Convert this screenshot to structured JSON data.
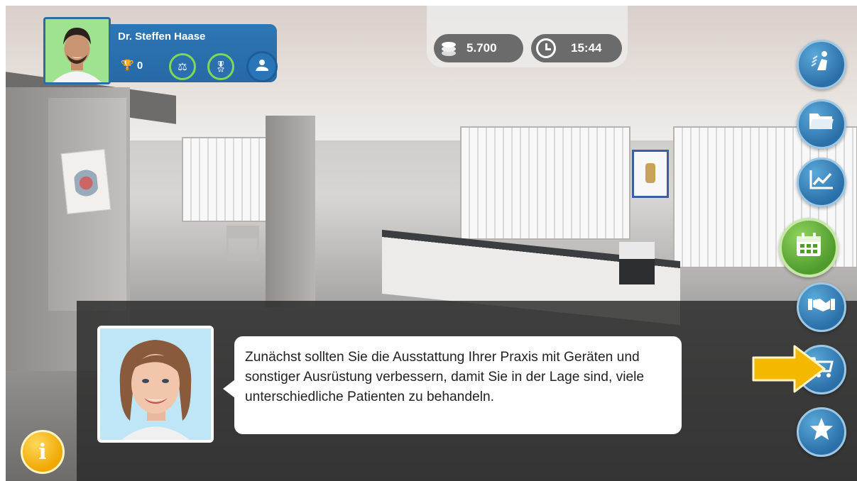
{
  "player": {
    "name": "Dr. Steffen Haase",
    "trophies": "0",
    "badges": [
      "scale-icon",
      "award-icon",
      "user-hand-icon"
    ]
  },
  "resources": {
    "money": "5.700",
    "time": "15:44"
  },
  "side_menu": [
    {
      "id": "staff",
      "icon": "staff-icon"
    },
    {
      "id": "files",
      "icon": "folder-icon"
    },
    {
      "id": "stats",
      "icon": "chart-icon"
    },
    {
      "id": "calendar",
      "icon": "calendar-icon",
      "active": true
    },
    {
      "id": "deal",
      "icon": "handshake-icon"
    },
    {
      "id": "shop",
      "icon": "cart-icon",
      "highlighted": true
    },
    {
      "id": "favorites",
      "icon": "star-icon"
    }
  ],
  "dialogue": {
    "text": "Zunächst sollten Sie die Ausstattung Ihrer Praxis mit Geräten und sonstiger Ausrüstung verbessern, damit Sie in der Lage sind, viele unterschiedliche Patienten zu behandeln."
  },
  "colors": {
    "primary_blue": "#2b6fa8",
    "badge_green": "#7ed957",
    "highlight_yellow": "#f5b800",
    "calendar_green": "#4f9b2e"
  }
}
